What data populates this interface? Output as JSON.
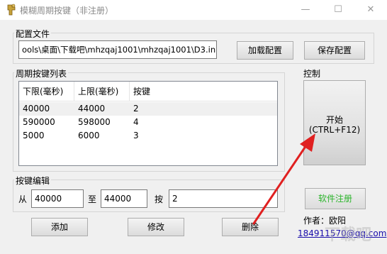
{
  "window": {
    "title": "模糊周期按键（非注册）",
    "icons": {
      "app": "app-icon",
      "min": "minimize-icon",
      "max": "maximize-icon",
      "close": "close-icon"
    },
    "min_glyph": "—",
    "max_glyph": "☐",
    "close_glyph": "✕"
  },
  "config": {
    "group_label": "配置文件",
    "file_path": "ools\\桌面\\下载吧\\mhzqaj1001\\mhzqaj1001\\D3.ini",
    "load_label": "加载配置",
    "save_label": "保存配置"
  },
  "list": {
    "group_label": "周期按键列表",
    "columns": [
      "下限(毫秒)",
      "上限(毫秒)",
      "按键"
    ],
    "rows": [
      {
        "low": "40000",
        "high": "44000",
        "key": "2",
        "selected": true
      },
      {
        "low": "590000",
        "high": "598000",
        "key": "4",
        "selected": false
      },
      {
        "low": "5000",
        "high": "6000",
        "key": "3",
        "selected": false
      }
    ]
  },
  "control": {
    "group_label": "控制",
    "start_line1": "开始",
    "start_line2": "(CTRL+F12)",
    "register_label": "软件注册"
  },
  "edit": {
    "group_label": "按键编辑",
    "from_label": "从",
    "from_value": "40000",
    "to_label": "至",
    "to_value": "44000",
    "key_label": "按",
    "key_value": "2",
    "add_label": "添加",
    "modify_label": "修改",
    "delete_label": "删除"
  },
  "about": {
    "author": "作者：欧阳",
    "contact": "184911570@qq.com"
  },
  "annotation": {
    "color": "#e02020"
  }
}
